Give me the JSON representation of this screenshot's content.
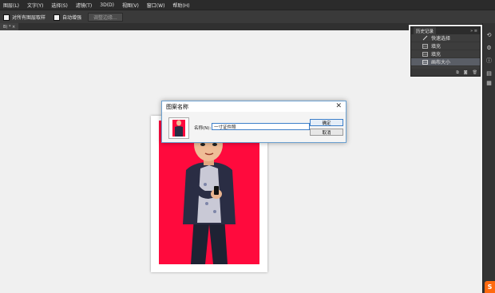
{
  "menubar": {
    "items": [
      "图层(L)",
      "文字(Y)",
      "选择(S)",
      "滤镜(T)",
      "3D(D)",
      "视图(V)",
      "窗口(W)",
      "帮助(H)"
    ]
  },
  "options_bar": {
    "sample_all_label": "对所有图层取样",
    "auto_enhance_label": "自动增强",
    "refine_edge_label": "调整边缘..."
  },
  "document_tab": {
    "label": "B) * ×"
  },
  "history_panel": {
    "title": "历史记录",
    "items": [
      {
        "label": "快速选择",
        "icon": "brush-icon"
      },
      {
        "label": "填充",
        "icon": "layer-icon"
      },
      {
        "label": "填充",
        "icon": "layer-icon"
      },
      {
        "label": "画布大小",
        "icon": "layer-icon",
        "selected": true
      }
    ]
  },
  "dialog": {
    "title": "图案名称",
    "name_label": "名称(N):",
    "name_value": "一寸证件照",
    "ok_label": "确定",
    "cancel_label": "取消"
  },
  "colors": {
    "artwork_background": "#ff0a3d",
    "ui_dark": "#2b2b2b",
    "canvas_bg": "#f0f0f0",
    "logo": "#ff6a10"
  }
}
